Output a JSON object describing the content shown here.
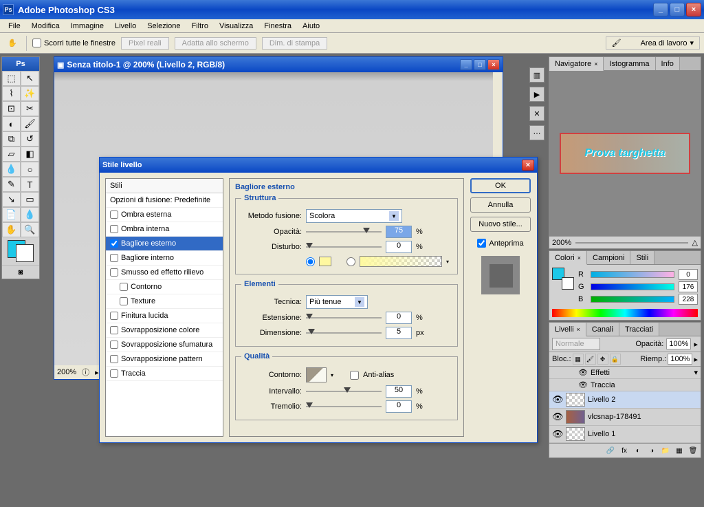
{
  "app": {
    "title": "Adobe Photoshop CS3",
    "ps_label": "Ps"
  },
  "menu": [
    "File",
    "Modifica",
    "Immagine",
    "Livello",
    "Selezione",
    "Filtro",
    "Visualizza",
    "Finestra",
    "Aiuto"
  ],
  "options": {
    "scroll_all": "Scorri tutte le finestre",
    "btns": [
      "Pixel reali",
      "Adatta allo schermo",
      "Dim. di stampa"
    ],
    "workspace": "Area di lavoro"
  },
  "document": {
    "title": "Senza titolo-1 @ 200% (Livello 2, RGB/8)",
    "zoom": "200%"
  },
  "dialog": {
    "title": "Stile livello",
    "styles_head": "Stili",
    "blend_opts": "Opzioni di fusione: Predefinite",
    "items": [
      {
        "label": "Ombra esterna",
        "checked": false
      },
      {
        "label": "Ombra interna",
        "checked": false
      },
      {
        "label": "Bagliore esterno",
        "checked": true,
        "selected": true
      },
      {
        "label": "Bagliore interno",
        "checked": false
      },
      {
        "label": "Smusso ed effetto rilievo",
        "checked": false
      },
      {
        "label": "Contorno",
        "checked": false,
        "indent": true
      },
      {
        "label": "Texture",
        "checked": false,
        "indent": true
      },
      {
        "label": "Finitura lucida",
        "checked": false
      },
      {
        "label": "Sovrapposizione colore",
        "checked": false
      },
      {
        "label": "Sovrapposizione sfumatura",
        "checked": false
      },
      {
        "label": "Sovrapposizione pattern",
        "checked": false
      },
      {
        "label": "Traccia",
        "checked": false
      }
    ],
    "section_title": "Bagliore esterno",
    "struttura": {
      "legend": "Struttura",
      "method_label": "Metodo fusione:",
      "method_value": "Scolora",
      "opacity_label": "Opacità:",
      "opacity_value": "75",
      "noise_label": "Disturbo:",
      "noise_value": "0",
      "percent": "%"
    },
    "elementi": {
      "legend": "Elementi",
      "tech_label": "Tecnica:",
      "tech_value": "Più tenue",
      "spread_label": "Estensione:",
      "spread_value": "0",
      "size_label": "Dimensione:",
      "size_value": "5",
      "px": "px",
      "percent": "%"
    },
    "qualita": {
      "legend": "Qualità",
      "contour_label": "Contorno:",
      "antialias": "Anti-alias",
      "range_label": "Intervallo:",
      "range_value": "50",
      "jitter_label": "Tremolio:",
      "jitter_value": "0",
      "percent": "%"
    },
    "buttons": {
      "ok": "OK",
      "cancel": "Annulla",
      "new_style": "Nuovo stile...",
      "preview": "Anteprima"
    }
  },
  "navigator": {
    "tabs": [
      "Navigatore",
      "Istogramma",
      "Info"
    ],
    "thumb_text": "Prova targhetta",
    "zoom": "200%"
  },
  "colors": {
    "tabs": [
      "Colori",
      "Campioni",
      "Stili"
    ],
    "r": {
      "label": "R",
      "value": "0"
    },
    "g": {
      "label": "G",
      "value": "176"
    },
    "b": {
      "label": "B",
      "value": "228"
    }
  },
  "layers": {
    "tabs": [
      "Livelli",
      "Canali",
      "Tracciati"
    ],
    "blend": "Normale",
    "opacity_label": "Opacità:",
    "opacity_value": "100%",
    "lock_label": "Bloc.:",
    "fill_label": "Riemp.:",
    "fill_value": "100%",
    "rows": [
      {
        "name": "Effetti",
        "fx": true,
        "indent": true
      },
      {
        "name": "Traccia",
        "indent": true,
        "sub": true
      },
      {
        "name": "Livello 2",
        "sel": true,
        "thumb": "checker"
      },
      {
        "name": "vlcsnap-178491",
        "thumb": "img"
      },
      {
        "name": "Livello 1",
        "thumb": "checker"
      }
    ]
  }
}
